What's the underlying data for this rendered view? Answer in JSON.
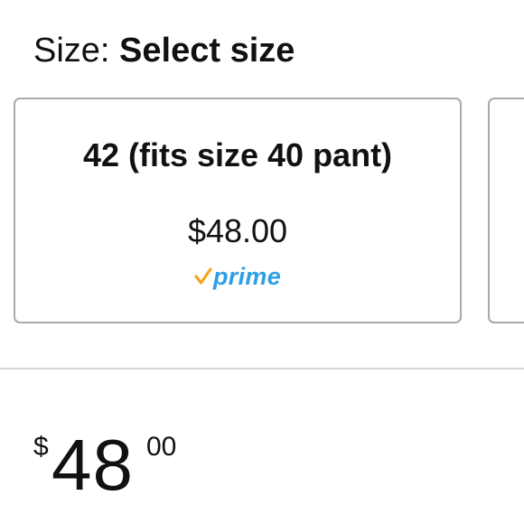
{
  "size_selector": {
    "label": "Size:",
    "selected_value": "Select size"
  },
  "size_options": [
    {
      "name": "42 (fits size 40 pant)",
      "price": "$48.00",
      "badge": "prime",
      "badge_check_color": "#f7a31c",
      "badge_text_color": "#2f9ee5"
    }
  ],
  "price": {
    "currency": "$",
    "whole": "48",
    "fraction": "00"
  },
  "colors": {
    "card_border": "#a9a9a9",
    "divider": "#d5d5d5",
    "text": "#111111"
  }
}
